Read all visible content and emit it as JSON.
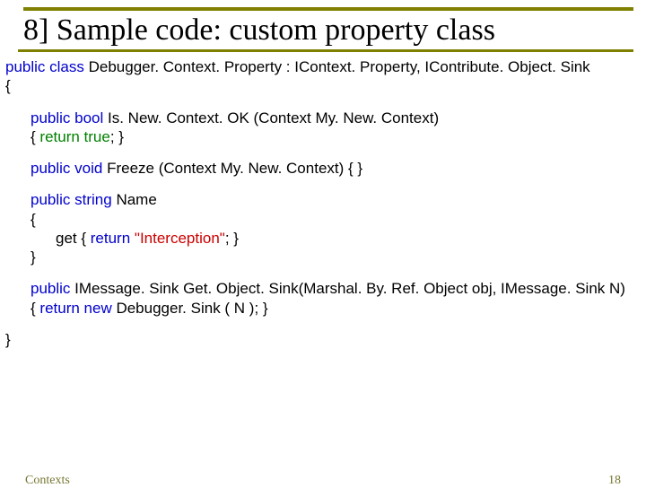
{
  "title": "8] Sample code: custom property class",
  "code": {
    "l1a": "public class ",
    "l1b": "Debugger. Context. Property : IContext. Property, IContribute. Object. Sink",
    "l2": "{",
    "l3a": "public bool ",
    "l3b": "Is. New. Context. OK (Context My. New. Context)",
    "l4a": "{        ",
    "l4b": "return true",
    "l4c": ";             }",
    "l5a": "public void ",
    "l5b": "Freeze (Context My. New. Context) { }",
    "l6a": "public string ",
    "l6b": "Name",
    "l7": "{",
    "l8a": "get  {      ",
    "l8b": "return ",
    "l8c": "\"Interception\"",
    "l8d": ";          }",
    "l9": "}",
    "l10a": "public ",
    "l10b": "IMessage. Sink Get. Object. Sink(Marshal. By. Ref. Object obj, IMessage. Sink N)",
    "l11a": "{       ",
    "l11b": "return new ",
    "l11c": "Debugger. Sink ( N ); ",
    "l11d": "   }",
    "l12": "}"
  },
  "footer": {
    "left": "Contexts",
    "right": "18"
  }
}
